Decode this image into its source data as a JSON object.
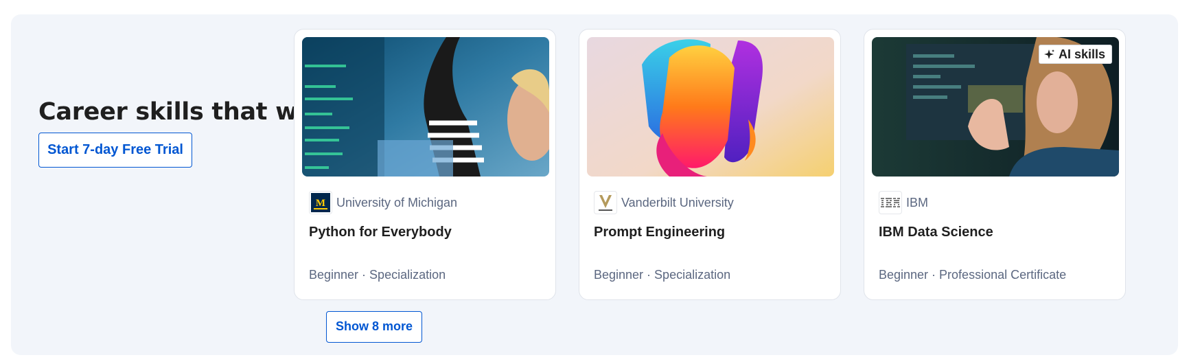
{
  "section": {
    "heading": "Career skills that work",
    "trial_button": "Start 7-day Free Trial",
    "show_more_button": "Show 8 more"
  },
  "cards": [
    {
      "partner": "University of Michigan",
      "partner_logo": "michigan-logo",
      "title": "Python for Everybody",
      "meta": "Beginner · Specialization",
      "image": "people-coding-image"
    },
    {
      "partner": "Vanderbilt University",
      "partner_logo": "vanderbilt-logo",
      "title": "Prompt Engineering",
      "meta": "Beginner · Specialization",
      "image": "abstract-colorful-shape-image"
    },
    {
      "partner": "IBM",
      "partner_logo": "ibm-logo",
      "title": "IBM Data Science",
      "meta": "Beginner · Professional Certificate",
      "image": "woman-at-monitor-image",
      "badge": "AI skills",
      "badge_icon": "sparkle-icon"
    }
  ],
  "colors": {
    "accent": "#0056d2",
    "panel_background": "#f2f5fa",
    "muted_text": "#5b6780",
    "heading_text": "#1f1f1f"
  }
}
